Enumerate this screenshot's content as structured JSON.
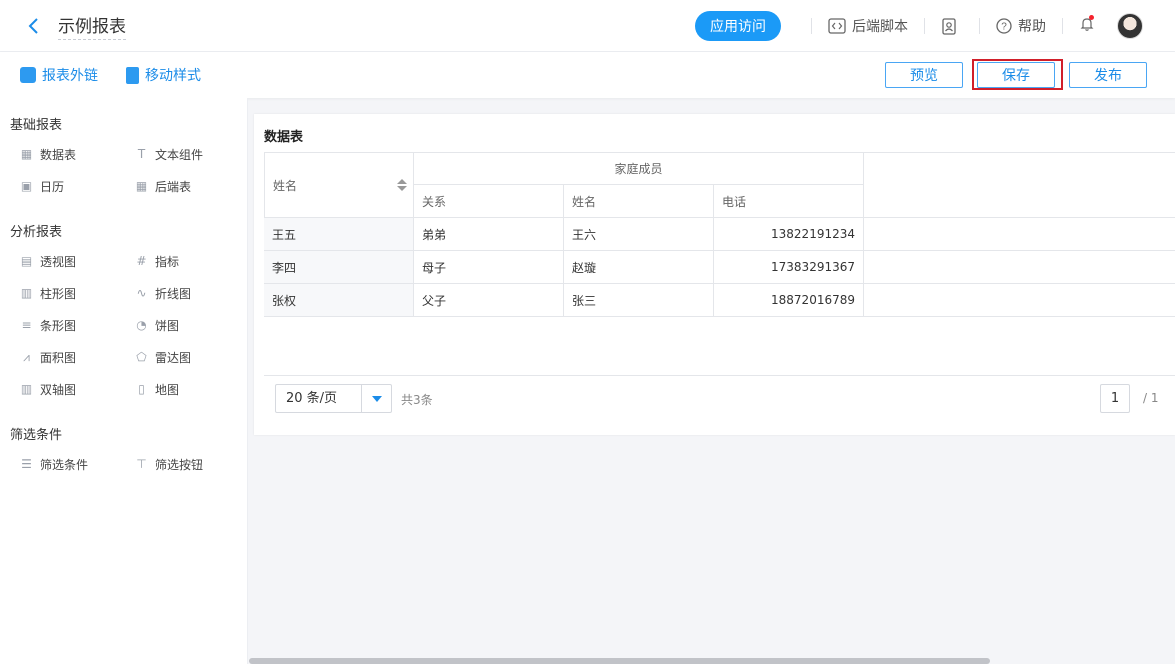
{
  "header": {
    "title": "示例报表",
    "app_button": "应用访问",
    "backend_script": "后端脚本",
    "help": "帮助",
    "accent": "#1b9af7"
  },
  "toolbar": {
    "external_link": "报表外链",
    "mobile_style": "移动样式",
    "preview": "预览",
    "save": "保存",
    "publish": "发布"
  },
  "sidebar": {
    "groups": [
      {
        "title": "基础报表",
        "items": [
          {
            "label": "数据表",
            "icon": "table-icon"
          },
          {
            "label": "文本组件",
            "icon": "text-icon"
          },
          {
            "label": "日历",
            "icon": "calendar-icon"
          },
          {
            "label": "后端表",
            "icon": "backend-table-icon"
          }
        ]
      },
      {
        "title": "分析报表",
        "items": [
          {
            "label": "透视图",
            "icon": "pivot-icon"
          },
          {
            "label": "指标",
            "icon": "metric-icon"
          },
          {
            "label": "柱形图",
            "icon": "column-chart-icon"
          },
          {
            "label": "折线图",
            "icon": "line-chart-icon"
          },
          {
            "label": "条形图",
            "icon": "bar-chart-icon"
          },
          {
            "label": "饼图",
            "icon": "pie-chart-icon"
          },
          {
            "label": "面积图",
            "icon": "area-chart-icon"
          },
          {
            "label": "雷达图",
            "icon": "radar-chart-icon"
          },
          {
            "label": "双轴图",
            "icon": "dual-axis-icon"
          },
          {
            "label": "地图",
            "icon": "map-icon"
          }
        ]
      },
      {
        "title": "筛选条件",
        "items": [
          {
            "label": "筛选条件",
            "icon": "filter-condition-icon"
          },
          {
            "label": "筛选按钮",
            "icon": "filter-button-icon"
          }
        ]
      }
    ]
  },
  "table": {
    "title": "数据表",
    "name_header": "姓名",
    "group_header": "家庭成员",
    "sub_headers": [
      "关系",
      "姓名",
      "电话"
    ],
    "rows": [
      [
        "王五",
        "弟弟",
        "王六",
        "13822191234"
      ],
      [
        "李四",
        "母子",
        "赵璇",
        "17383291367"
      ],
      [
        "张权",
        "父子",
        "张三",
        "18872016789"
      ]
    ],
    "page_size": "20 条/页",
    "total": "共3条",
    "page": "1",
    "page_count": "/ 1"
  }
}
